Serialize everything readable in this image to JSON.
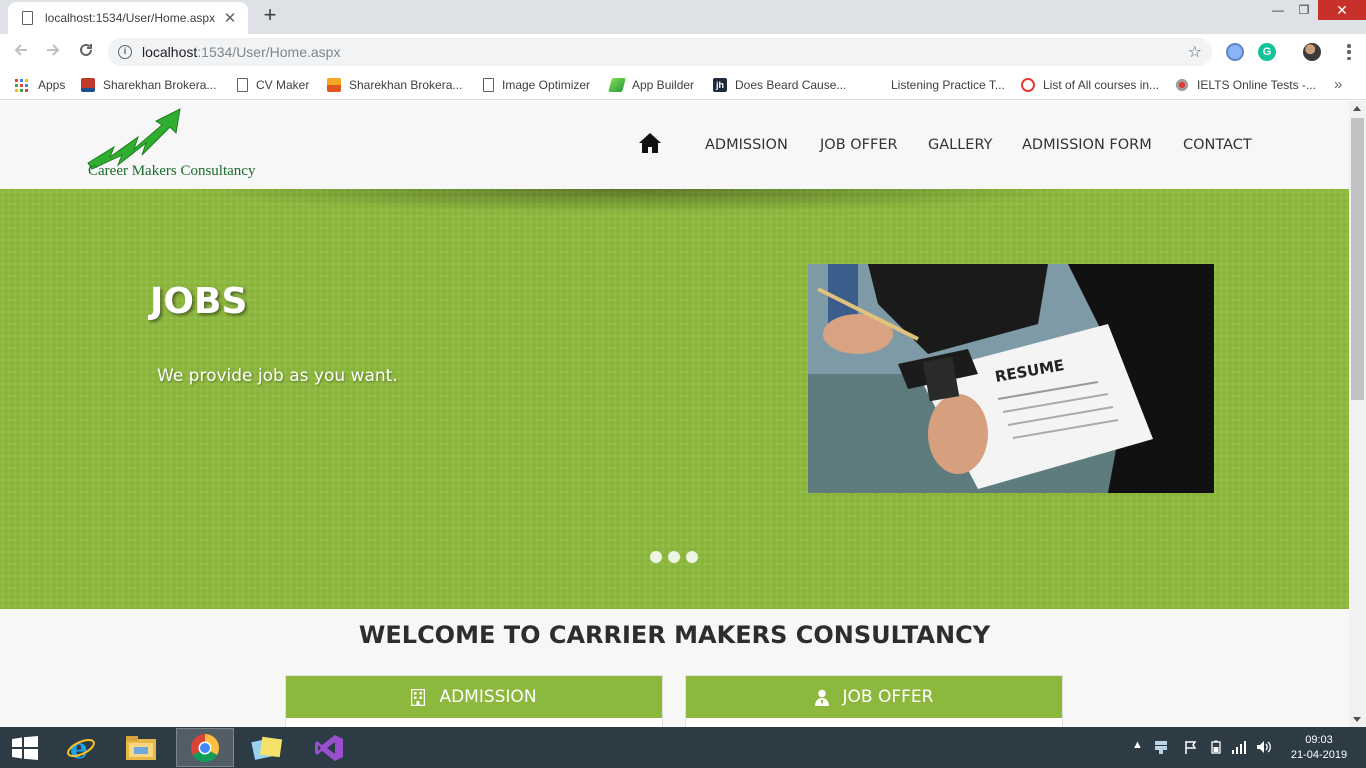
{
  "browser": {
    "tab_title": "localhost:1534/User/Home.aspx",
    "tab_close": "✕",
    "new_tab": "+",
    "url_host": "localhost",
    "url_path": ":1534/User/Home.aspx",
    "window_min": "—",
    "window_max": "❐",
    "window_close": "✕"
  },
  "bookmarks": [
    {
      "label": "Apps",
      "icon": "apps-grid-icon"
    },
    {
      "label": "Sharekhan Brokera...",
      "icon": "sharekhan-icon"
    },
    {
      "label": "CV Maker",
      "icon": "page-icon"
    },
    {
      "label": "Sharekhan Brokera...",
      "icon": "sharekhan-icon"
    },
    {
      "label": "Image Optimizer",
      "icon": "page-icon"
    },
    {
      "label": "App Builder",
      "icon": "app-builder-icon"
    },
    {
      "label": "Does Beard Cause...",
      "icon": "jh-icon"
    },
    {
      "label": "Listening Practice T...",
      "icon": "none"
    },
    {
      "label": "List of All courses in...",
      "icon": "courses-icon"
    },
    {
      "label": "IELTS Online Tests -...",
      "icon": "ielts-icon"
    }
  ],
  "site": {
    "logo_text": "Career Makers Consultancy",
    "nav": [
      "ADMISSION",
      "JOB OFFER",
      "GALLERY",
      "ADMISSION FORM",
      "CONTACT"
    ],
    "hero": {
      "title": "JOBS",
      "subtitle": "We provide job as you want.",
      "image_caption": "RESUME",
      "slide_count": 3
    },
    "welcome": "WELCOME TO CARRIER MAKERS CONSULTANCY",
    "cards": [
      {
        "label": "ADMISSION",
        "icon": "building-icon"
      },
      {
        "label": "JOB OFFER",
        "icon": "user-tie-icon"
      }
    ],
    "accent_color": "#8db83e"
  },
  "taskbar": {
    "time": "09:03",
    "date": "21-04-2019",
    "apps": [
      "start",
      "internet-explorer",
      "file-explorer",
      "chrome",
      "photos",
      "visual-studio"
    ]
  }
}
